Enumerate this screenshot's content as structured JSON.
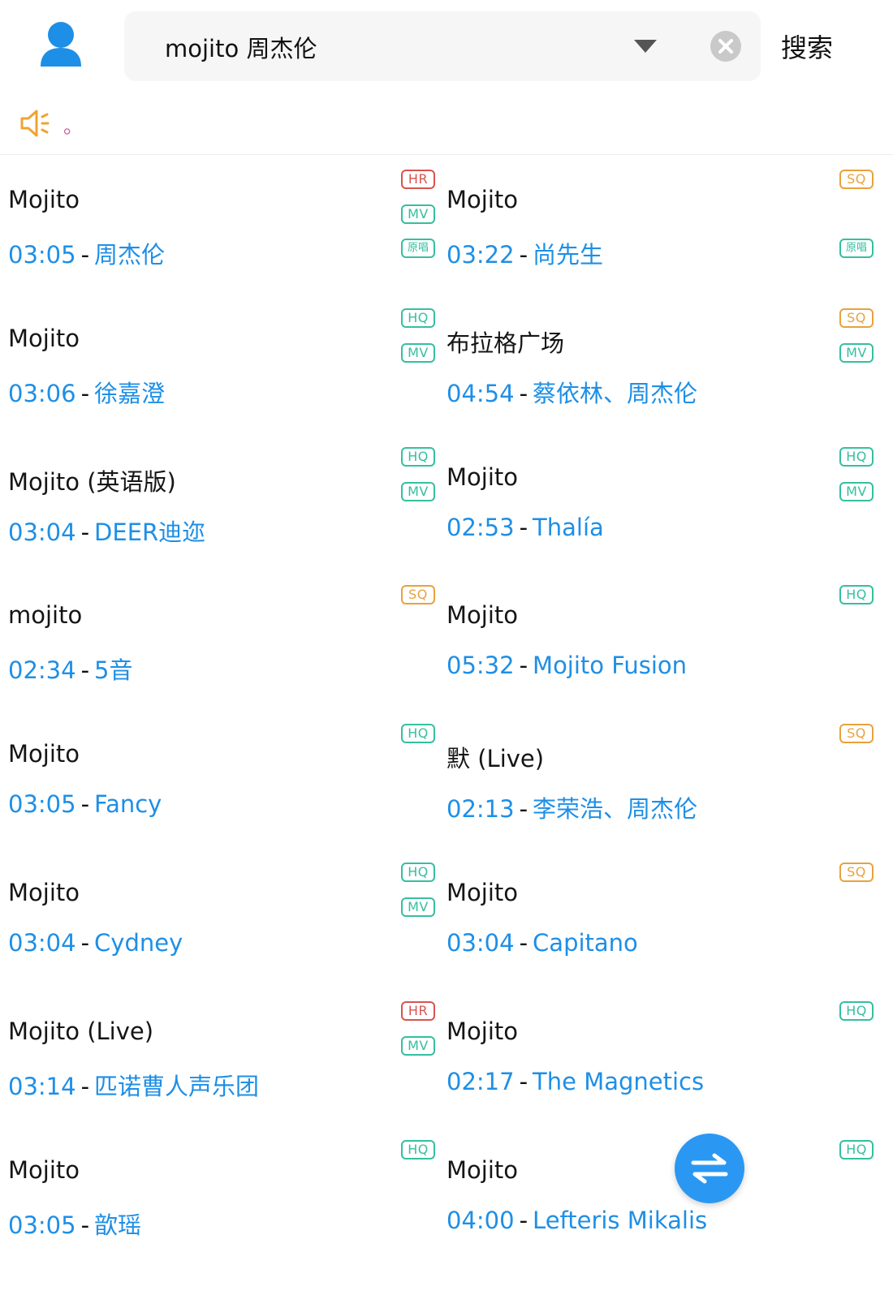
{
  "header": {
    "avatar_icon": "user-icon",
    "search": {
      "value": "mojito 周杰伦",
      "placeholder": ""
    },
    "dropdown_icon": "caret-down-icon",
    "clear_icon": "clear-circle-icon",
    "search_button_label": "搜索"
  },
  "notice": {
    "icon": "speaker-icon",
    "text": "。"
  },
  "colors": {
    "blue": "#1e8fe6",
    "hr": "#d9534f",
    "hq": "#35bfa0",
    "mv": "#35bfa0",
    "original": "#35bfa0",
    "sq": "#e8a23e",
    "fab": "#2a98f3"
  },
  "songs_left": [
    {
      "title": "Mojito",
      "duration": "03:05",
      "artist": "周杰伦",
      "badges": [
        {
          "text": "HR",
          "kind": "hr"
        },
        {
          "text": "MV",
          "kind": "mv"
        },
        {
          "text": "原唱",
          "kind": "original"
        }
      ]
    },
    {
      "title": "Mojito",
      "duration": "03:06",
      "artist": "徐嘉澄",
      "badges": [
        {
          "text": "HQ",
          "kind": "hq"
        },
        {
          "text": "MV",
          "kind": "mv"
        }
      ]
    },
    {
      "title": "Mojito (英语版)",
      "duration": "03:04",
      "artist": "DEER迪迩",
      "badges": [
        {
          "text": "HQ",
          "kind": "hq"
        },
        {
          "text": "MV",
          "kind": "mv"
        }
      ]
    },
    {
      "title": "mojito",
      "duration": "02:34",
      "artist": "5音",
      "badges": [
        {
          "text": "SQ",
          "kind": "sq"
        }
      ]
    },
    {
      "title": "Mojito",
      "duration": "03:05",
      "artist": "Fancy",
      "badges": [
        {
          "text": "HQ",
          "kind": "hq"
        }
      ]
    },
    {
      "title": "Mojito",
      "duration": "03:04",
      "artist": "Cydney",
      "badges": [
        {
          "text": "HQ",
          "kind": "hq"
        },
        {
          "text": "MV",
          "kind": "mv"
        }
      ]
    },
    {
      "title": "Mojito (Live)",
      "duration": "03:14",
      "artist": "匹诺曹人声乐团",
      "badges": [
        {
          "text": "HR",
          "kind": "hr"
        },
        {
          "text": "MV",
          "kind": "mv"
        }
      ]
    },
    {
      "title": "Mojito",
      "duration": "03:05",
      "artist": "歆瑶",
      "badges": [
        {
          "text": "HQ",
          "kind": "hq"
        }
      ]
    }
  ],
  "songs_right": [
    {
      "title": "Mojito",
      "duration": "03:22",
      "artist": "尚先生",
      "badges": [
        {
          "text": "SQ",
          "kind": "sq"
        },
        {
          "text": "原唱",
          "kind": "original",
          "slot": 2
        }
      ]
    },
    {
      "title": "布拉格广场",
      "duration": "04:54",
      "artist": "蔡依林、周杰伦",
      "badges": [
        {
          "text": "SQ",
          "kind": "sq"
        },
        {
          "text": "MV",
          "kind": "mv"
        }
      ]
    },
    {
      "title": "Mojito",
      "duration": "02:53",
      "artist": "Thalía",
      "badges": [
        {
          "text": "HQ",
          "kind": "hq"
        },
        {
          "text": "MV",
          "kind": "mv"
        }
      ]
    },
    {
      "title": "Mojito",
      "duration": "05:32",
      "artist": "Mojito Fusion",
      "badges": [
        {
          "text": "HQ",
          "kind": "hq"
        }
      ]
    },
    {
      "title": "默 (Live)",
      "duration": "02:13",
      "artist": "李荣浩、周杰伦",
      "badges": [
        {
          "text": "SQ",
          "kind": "sq"
        }
      ]
    },
    {
      "title": "Mojito",
      "duration": "03:04",
      "artist": "Capitano",
      "badges": [
        {
          "text": "SQ",
          "kind": "sq"
        }
      ]
    },
    {
      "title": "Mojito",
      "duration": "02:17",
      "artist": "The Magnetics",
      "badges": [
        {
          "text": "HQ",
          "kind": "hq"
        }
      ]
    },
    {
      "title": "Mojito",
      "duration": "04:00",
      "artist": "Lefteris Mikalis",
      "badges": [
        {
          "text": "HQ",
          "kind": "hq"
        }
      ]
    }
  ],
  "fab": {
    "icon": "swap-arrows-icon"
  }
}
